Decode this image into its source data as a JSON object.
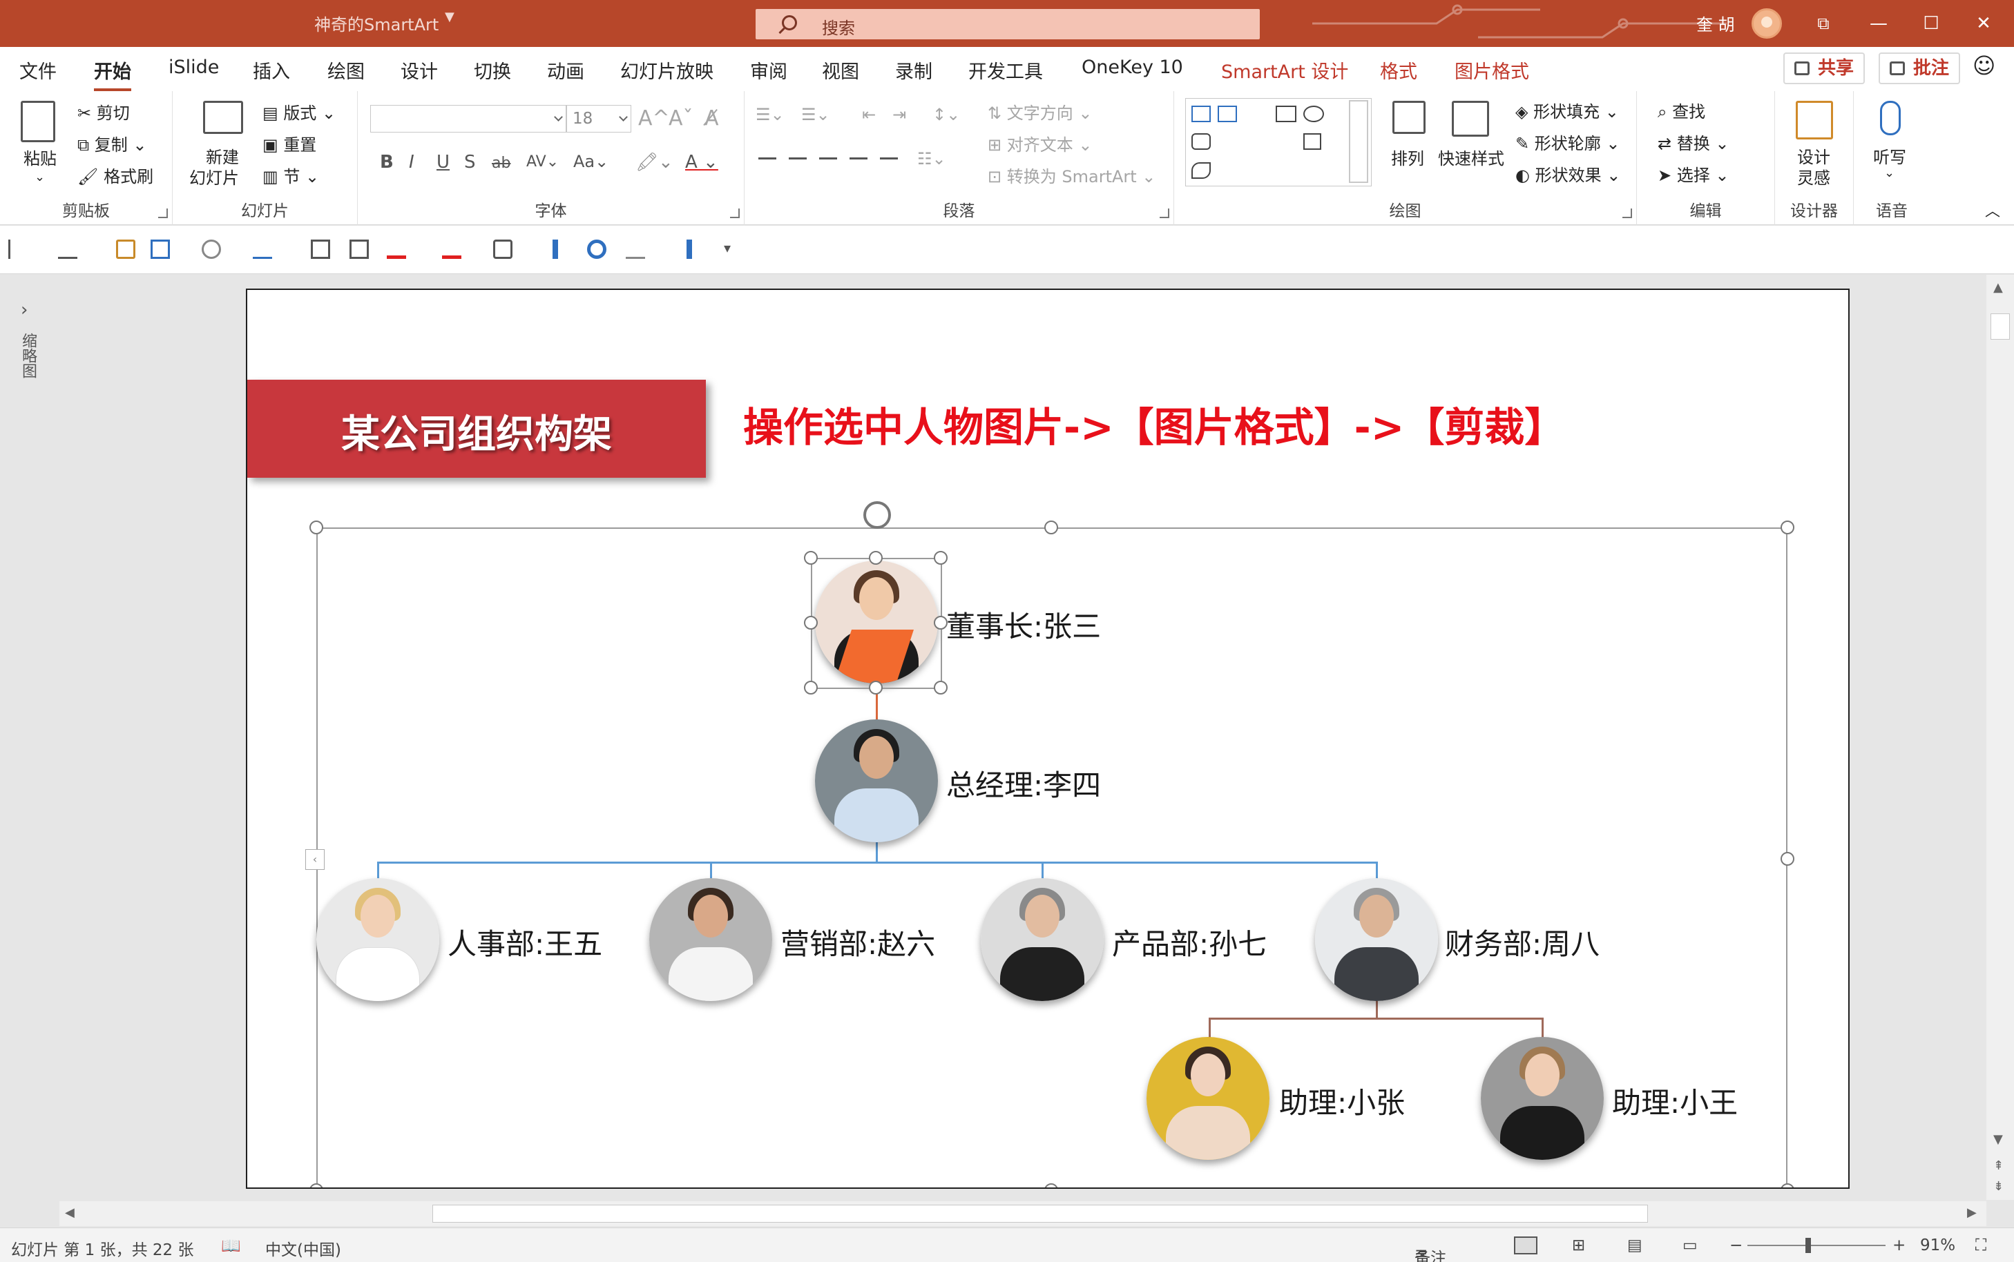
{
  "titlebar": {
    "doc_title": "神奇的SmartArt",
    "search_placeholder": "搜索",
    "user_name": "奎 胡",
    "minimize": "—",
    "restore": "☐",
    "close": "✕",
    "ribbon_display": "⧉"
  },
  "menu": {
    "tabs": [
      "文件",
      "开始",
      "iSlide",
      "插入",
      "绘图",
      "设计",
      "切换",
      "动画",
      "幻灯片放映",
      "审阅",
      "视图",
      "录制",
      "开发工具",
      "OneKey 10"
    ],
    "context_tabs": [
      "SmartArt 设计",
      "格式",
      "图片格式"
    ],
    "active_tab": "开始",
    "share": "共享",
    "comments": "批注"
  },
  "ribbon": {
    "clipboard": {
      "label": "剪贴板",
      "paste": "粘贴",
      "cut": "剪切",
      "copy": "复制",
      "format_painter": "格式刷"
    },
    "slides": {
      "label": "幻灯片",
      "new_slide_1": "新建",
      "new_slide_2": "幻灯片",
      "layout": "版式",
      "reset": "重置",
      "section": "节"
    },
    "font": {
      "label": "字体",
      "font_name": "",
      "font_size": "18"
    },
    "paragraph": {
      "label": "段落",
      "text_direction": "文字方向",
      "align_text": "对齐文本",
      "convert_smartart": "转换为 SmartArt"
    },
    "drawing": {
      "label": "绘图",
      "arrange": "排列",
      "quick_styles": "快速样式",
      "shape_fill": "形状填充",
      "shape_outline": "形状轮廓",
      "shape_effects": "形状效果"
    },
    "editing": {
      "label": "编辑",
      "find": "查找",
      "replace": "替换",
      "select": "选择"
    },
    "designer": {
      "label": "设计器",
      "design_1": "设计",
      "design_2": "灵感"
    },
    "voice": {
      "label": "语音",
      "dictate": "听写"
    }
  },
  "leftpane": {
    "thumbnails_label": "缩略图"
  },
  "slide": {
    "title": "某公司组织构架",
    "instruction": "操作选中人物图片->【图片格式】->【剪裁】",
    "nodes": {
      "chairman": "董事长:张三",
      "gm": "总经理:李四",
      "hr": "人事部:王五",
      "marketing": "营销部:赵六",
      "product": "产品部:孙七",
      "finance": "财务部:周八",
      "assistant_zhang": "助理:小张",
      "assistant_wang": "助理:小王"
    }
  },
  "statusbar": {
    "slide_info": "幻灯片 第 1 张，共 22 张",
    "language": "中文(中国)",
    "notes": "备注",
    "zoom": "91%"
  },
  "colors": {
    "accent": "#b7472a",
    "title_banner": "#c8373d",
    "instruction_text": "#e8101a",
    "connector_blue": "#5b9bd5",
    "connector_brown": "#a06a5a"
  }
}
